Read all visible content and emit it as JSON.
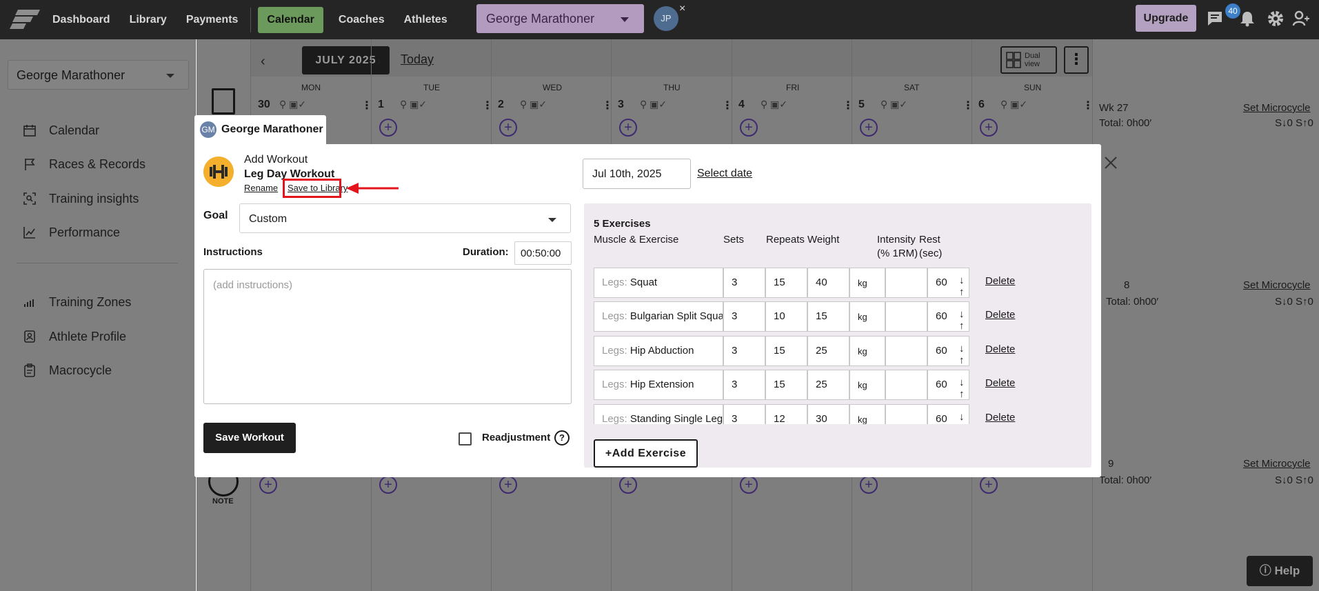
{
  "nav": {
    "items": [
      "Dashboard",
      "Library",
      "Payments"
    ],
    "active": "Calendar",
    "items2": [
      "Coaches",
      "Athletes"
    ],
    "athlete_selected": "George Marathoner",
    "user_initials": "JP",
    "close_glyph": "×",
    "upgrade_label": "Upgrade",
    "notification_count": "40"
  },
  "sidebar": {
    "athlete_selected": "George Marathoner",
    "items": [
      {
        "label": "Calendar",
        "icon": "calendar-icon"
      },
      {
        "label": "Races & Records",
        "icon": "flag-icon"
      },
      {
        "label": "Training insights",
        "icon": "insights-icon"
      },
      {
        "label": "Performance",
        "icon": "chart-icon"
      },
      {
        "label": "Training Zones",
        "icon": "zones-icon"
      },
      {
        "label": "Athlete Profile",
        "icon": "profile-icon"
      },
      {
        "label": "Macrocycle",
        "icon": "clipboard-icon"
      }
    ]
  },
  "calendar": {
    "month": "JULY 2025",
    "today_label": "Today",
    "dual_view_label": "Dual view",
    "more_glyph": "⋮",
    "days": [
      {
        "name": "MON",
        "num": "30"
      },
      {
        "name": "TUE",
        "num": "1"
      },
      {
        "name": "WED",
        "num": "2"
      },
      {
        "name": "THU",
        "num": "3"
      },
      {
        "name": "FRI",
        "num": "4"
      },
      {
        "name": "SAT",
        "num": "5"
      },
      {
        "name": "SUN",
        "num": "6"
      }
    ],
    "week": {
      "label": "Wk 27",
      "total": "Total: 0h00′",
      "set_micro": "Set Microcycle",
      "values": "S↓0 S↑0"
    },
    "week2_partial": "8",
    "week3_partial": "9",
    "note_label": "NOTE",
    "help_label": "Help"
  },
  "modal": {
    "athlete_initials": "GM",
    "athlete_name": "George Marathoner",
    "type_label": "Add Workout",
    "workout_name": "Leg Day Workout",
    "rename_label": "Rename",
    "save_library_label": "Save to Library",
    "goal_label": "Goal",
    "goal_value": "Custom",
    "instructions_label": "Instructions",
    "instructions_placeholder": "(add instructions)",
    "duration_label": "Duration:",
    "duration_value": "00:50:00",
    "save_button": "Save Workout",
    "readjustment_label": "Readjustment",
    "date_value": "Jul 10th, 2025",
    "select_date_label": "Select date",
    "exercises": {
      "count_label": "5 Exercises",
      "headers": {
        "muscle_exercise": "Muscle & Exercise",
        "sets": "Sets",
        "repeats": "Repeats",
        "weight": "Weight",
        "intensity": "Intensity (% 1RM)",
        "rest": "Rest (sec)"
      },
      "rows": [
        {
          "muscle": "Legs:",
          "name": "Squat",
          "sets": "3",
          "repeats": "15",
          "weight": "40",
          "unit": "kg",
          "intensity": "",
          "rest": "60"
        },
        {
          "muscle": "Legs:",
          "name": "Bulgarian Split Squat",
          "sets": "3",
          "repeats": "10",
          "weight": "15",
          "unit": "kg",
          "intensity": "",
          "rest": "60"
        },
        {
          "muscle": "Legs:",
          "name": "Hip Abduction",
          "sets": "3",
          "repeats": "15",
          "weight": "25",
          "unit": "kg",
          "intensity": "",
          "rest": "60"
        },
        {
          "muscle": "Legs:",
          "name": "Hip Extension",
          "sets": "3",
          "repeats": "15",
          "weight": "25",
          "unit": "kg",
          "intensity": "",
          "rest": "60"
        },
        {
          "muscle": "Legs:",
          "name": "Standing Single Leg Ca",
          "sets": "3",
          "repeats": "12",
          "weight": "30",
          "unit": "kg",
          "intensity": "",
          "rest": "60"
        }
      ],
      "move_glyphs": "↓ ↑",
      "delete_label": "Delete",
      "add_label": "+Add Exercise"
    }
  },
  "colors": {
    "topnav": "#252526",
    "calendar_active": "#6c9a5c",
    "accent_purple": "#b29bbf",
    "highlight_red": "#e3141b",
    "exercise_panel": "#efe9f0"
  }
}
